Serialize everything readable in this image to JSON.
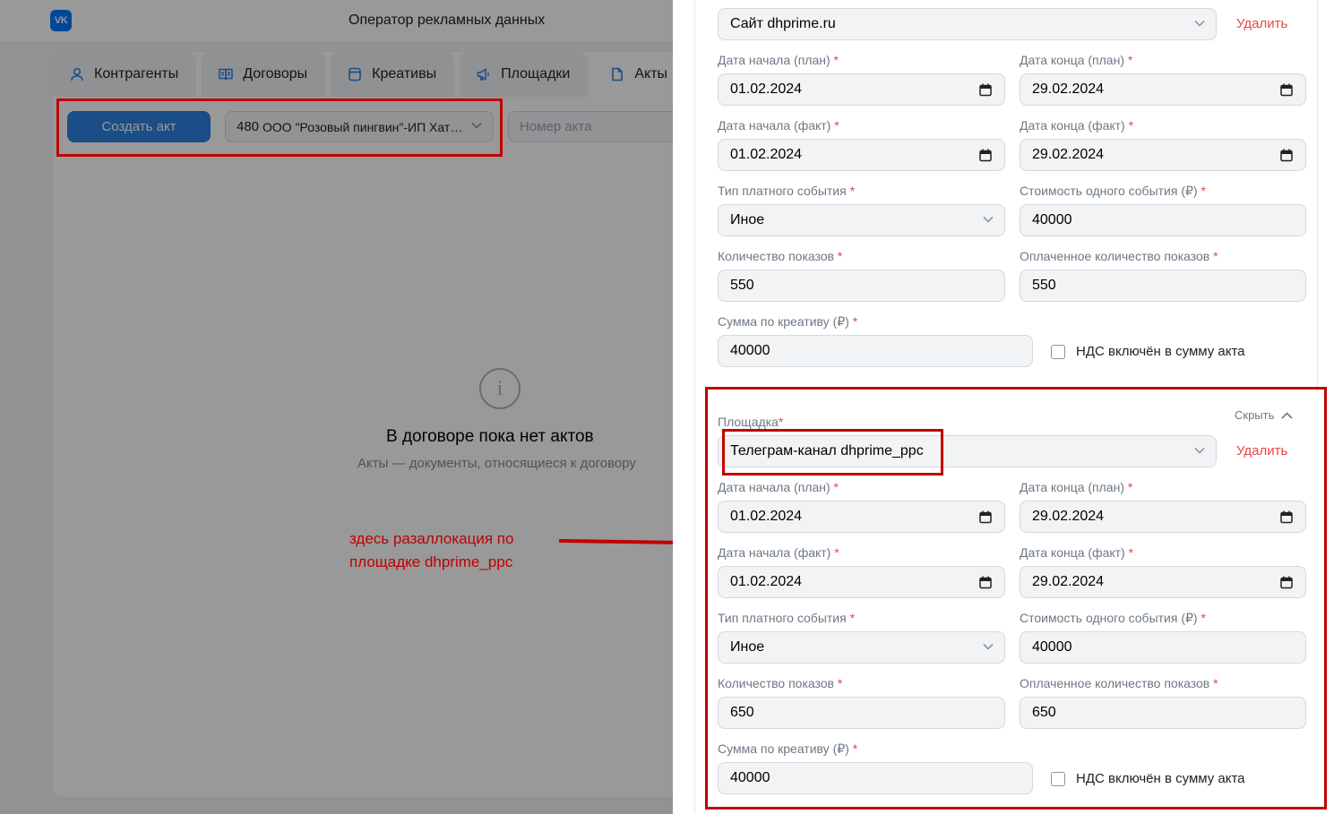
{
  "app": {
    "logo": "VK",
    "title": "Оператор рекламных данных"
  },
  "tabs": [
    {
      "label": "Контрагенты",
      "icon": "user-icon"
    },
    {
      "label": "Договоры",
      "icon": "book-icon"
    },
    {
      "label": "Креативы",
      "icon": "window-icon"
    },
    {
      "label": "Площадки",
      "icon": "megaphone-icon"
    },
    {
      "label": "Акты",
      "icon": "document-icon"
    }
  ],
  "toolbar": {
    "create_label": "Создать акт",
    "contract_number": "480",
    "contract_name": "ООО \"Розовый пингвин\"-ИП Хатунцев",
    "act_number_placeholder": "Номер акта"
  },
  "empty": {
    "icon": "info-icon",
    "glyph": "i",
    "title": "В договоре пока нет актов",
    "subtitle": "Акты — документы, относящиеся к договору"
  },
  "annotation": {
    "line1": "здесь разаллокация по",
    "line2": "площадке dhprime_ppc",
    "color": "#c00000"
  },
  "labels": {
    "platform": "Площадка",
    "start_plan": "Дата начала (план)",
    "end_plan": "Дата конца (план)",
    "start_fact": "Дата начала (факт)",
    "end_fact": "Дата конца (факт)",
    "event_type": "Тип платного события",
    "event_cost": "Стоимость одного события (₽)",
    "impressions": "Количество показов",
    "paid_impressions": "Оплаченное количество показов",
    "creative_sum": "Сумма по креативу (₽)",
    "vat": "НДС включён в сумму акта",
    "delete": "Удалить",
    "hide": "Скрыть",
    "required": "*"
  },
  "blocks": [
    {
      "platform": "Сайт dhprime.ru",
      "start_plan": "01.02.2024",
      "end_plan": "29.02.2024",
      "start_fact": "01.02.2024",
      "end_fact": "29.02.2024",
      "event_type": "Иное",
      "event_cost": "40000",
      "impressions": "550",
      "paid_impressions": "550",
      "creative_sum": "40000"
    },
    {
      "platform": "Телеграм-канал dhprime_ppc",
      "start_plan": "01.02.2024",
      "end_plan": "29.02.2024",
      "start_fact": "01.02.2024",
      "end_fact": "29.02.2024",
      "event_type": "Иное",
      "event_cost": "40000",
      "impressions": "650",
      "paid_impressions": "650",
      "creative_sum": "40000"
    }
  ],
  "colors": {
    "accent": "#2d81e0",
    "danger": "#e64646",
    "annotation": "#c00000"
  }
}
